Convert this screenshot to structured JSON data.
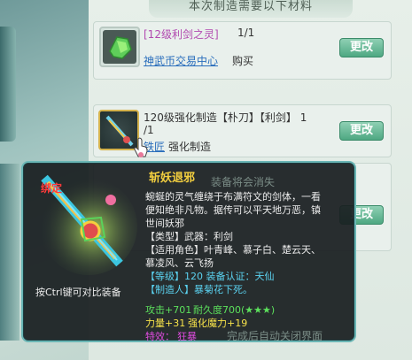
{
  "panel": {
    "header": "本次制造需要以下材料"
  },
  "rows": [
    {
      "item_name": "[12级利剑之灵]",
      "count": "1/1",
      "source_link": "神武币交易中心",
      "source_suffix": "购买",
      "button": "更改"
    },
    {
      "title": "120级强化制造【朴刀】【利剑】 1",
      "count": "/1",
      "source_link": "铁匠",
      "source_suffix": "强化制造",
      "button": "更改"
    },
    {
      "button": "更改"
    }
  ],
  "background_fragments": {
    "warn": "装备将会消失",
    "bottom": "完成后自动关闭界面"
  },
  "tooltip": {
    "bound_label": "绑定",
    "compare_hint": "按Ctrl键可对比装备",
    "name": "斩妖退邪",
    "desc1": "蜿蜒的灵气缠绕于布满符文的剑体，一看",
    "desc2": "便知绝非凡物。据传可以平天地万恶，镇",
    "desc3": "世间妖邪",
    "type": "【类型】武器：利剑",
    "roles1": "【适用角色】叶青峰、慕子白、楚云天、",
    "roles2": "慕凌风、云飞扬",
    "level": "【等级】120 装备认证：天仙",
    "maker": "【制造人】暴菊花下死。",
    "attack": "攻击+701",
    "durability": "耐久度700(★★★)",
    "stats_line_a": "力量+31",
    "stats_line_b": "强化魔力+19",
    "special_label": "特效：",
    "special_value": "狂暴"
  }
}
